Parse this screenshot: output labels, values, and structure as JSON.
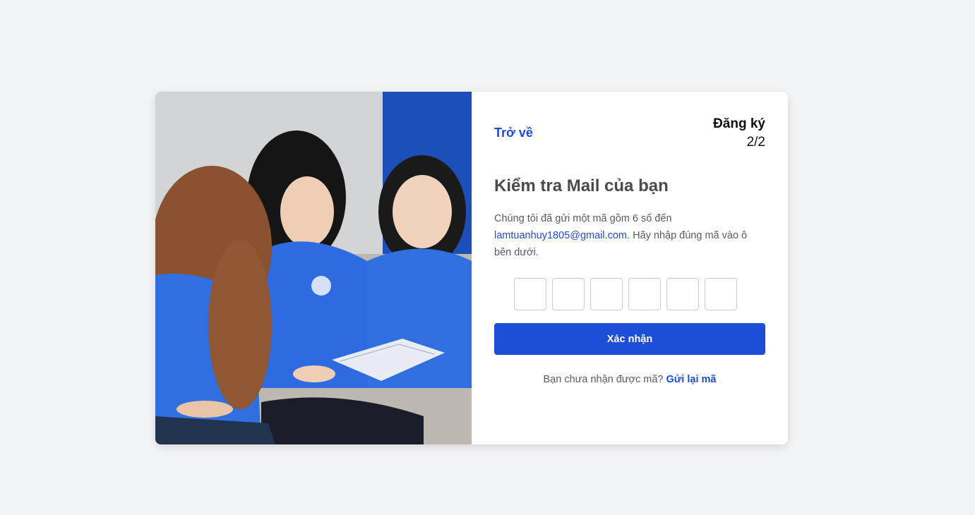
{
  "nav": {
    "back_label": "Trở về"
  },
  "step": {
    "title": "Đăng ký",
    "count": "2/2"
  },
  "main": {
    "heading": "Kiểm tra Mail của bạn",
    "description_prefix": "Chúng tôi đã gửi một mã gồm 6 số đến ",
    "email": "lamtuanhuy1805@gmail.com",
    "description_suffix": ". Hãy nhập đúng mã vào ô bên dưới.",
    "code_digits": [
      "",
      "",
      "",
      "",
      "",
      ""
    ],
    "confirm_label": "Xác nhận",
    "resend_prompt": "Bạn chưa nhận được mã?",
    "resend_label": "Gửi lại mã"
  },
  "colors": {
    "accent": "#1d4ed8",
    "background": "#f3f4f6",
    "uniform": "#2f6fe0"
  },
  "image": {
    "subject": "students-in-blue-uniforms-reading"
  }
}
